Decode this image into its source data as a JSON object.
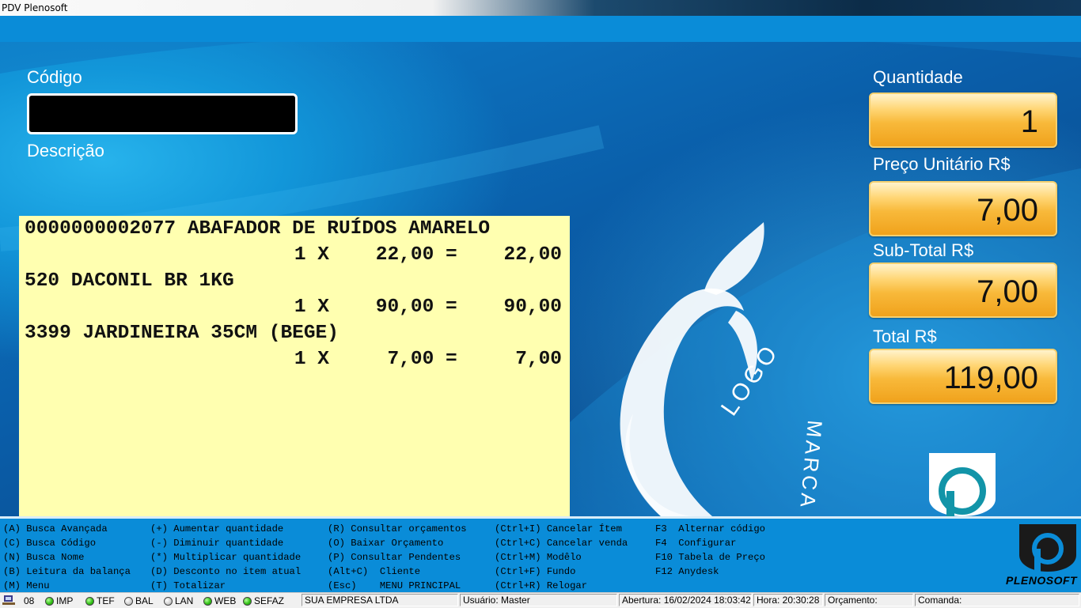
{
  "window": {
    "title": "PDV Plenosoft"
  },
  "labels": {
    "codigo": "Código",
    "descricao": "Descrição",
    "quantidade": "Quantidade",
    "preco_unitario": "Preço Unitário R$",
    "subtotal": "Sub-Total R$",
    "total": "Total R$"
  },
  "inputs": {
    "codigo_value": "",
    "descricao_value": ""
  },
  "values": {
    "quantidade": "1",
    "preco_unitario": "7,00",
    "subtotal": "7,00",
    "total": "119,00"
  },
  "receipt": {
    "items": [
      {
        "description": "0000000002077 ABAFADOR DE RUÍDOS AMARELO",
        "calc": "1 X    22,00 =    22,00"
      },
      {
        "description": "520 DACONIL BR 1KG",
        "calc": "1 X    90,00 =    90,00"
      },
      {
        "description": "3399 JARDINEIRA 35CM (BEGE)",
        "calc": "1 X     7,00 =     7,00"
      }
    ]
  },
  "watermark": {
    "logo": "LOGO",
    "marca": "MARCA"
  },
  "shortcuts": {
    "col1": [
      "(A) Busca Avançada",
      "(C) Busca Código",
      "(N) Busca Nome",
      "(B) Leitura da balança",
      "(M) Menu"
    ],
    "col2": [
      "(+) Aumentar quantidade",
      "(-) Diminuir quantidade",
      "(*) Multiplicar quantidade",
      "(D) Desconto no item atual",
      "(T) Totalizar"
    ],
    "col3": [
      "(R) Consultar orçamentos",
      "(O) Baixar Orçamento",
      "(P) Consultar Pendentes",
      "(Alt+C)  Cliente",
      "(Esc)    MENU PRINCIPAL"
    ],
    "col4": [
      "(Ctrl+I) Cancelar Ítem",
      "(Ctrl+C) Cancelar venda",
      "(Ctrl+M) Modêlo",
      "(Ctrl+F) Fundo",
      "(Ctrl+R) Relogar"
    ],
    "col5": [
      "F3  Alternar código",
      "F4  Configurar",
      "F10 Tabela de Preço",
      "F12 Anydesk"
    ]
  },
  "brand": {
    "name": "PLENOSOFT"
  },
  "status": {
    "terminal": "08",
    "indicators": [
      {
        "label": "IMP",
        "on": true
      },
      {
        "label": "TEF",
        "on": true
      },
      {
        "label": "BAL",
        "on": false
      },
      {
        "label": "LAN",
        "on": false
      },
      {
        "label": "WEB",
        "on": true
      },
      {
        "label": "SEFAZ",
        "on": true
      }
    ],
    "empresa": "SUA EMPRESA LTDA",
    "usuario": "Usuário: Master",
    "abertura": "Abertura: 16/02/2024 18:03:42",
    "hora": "Hora: 20:30:28",
    "orcamento": "Orçamento:",
    "comanda": "Comanda:"
  }
}
